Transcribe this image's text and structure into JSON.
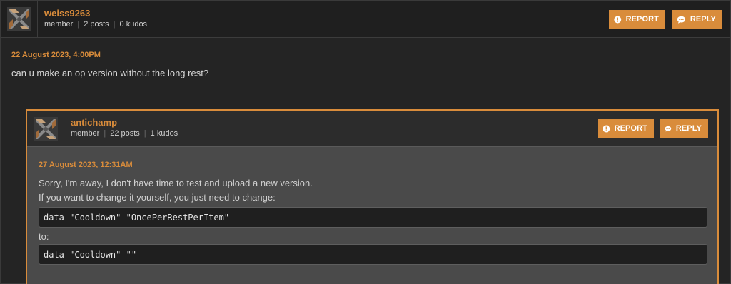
{
  "post": {
    "author": "weiss9263",
    "role": "member",
    "posts": "2 posts",
    "kudos": "0 kudos",
    "date": "22 August 2023, 4:00PM",
    "text": "can u make an op version without the long rest?",
    "report_label": "REPORT",
    "reply_label": "REPLY"
  },
  "reply": {
    "author": "antichamp",
    "role": "member",
    "posts": "22 posts",
    "kudos": "1 kudos",
    "date": "27 August 2023, 12:31AM",
    "line1": "Sorry, I'm away, I don't have time to test and upload a new version.",
    "line2": "If you want to change it yourself, you just need to change:",
    "code1": "data \"Cooldown\" \"OncePerRestPerItem\"",
    "to_label": "to:",
    "code2": "data \"Cooldown\" \"\"",
    "report_label": "REPORT",
    "reply_label": "REPLY"
  },
  "colors": {
    "accent": "#d98c3b",
    "background": "#242424",
    "reply_background": "#4a4a4a"
  },
  "icons": {
    "report": "exclamation-circle-icon",
    "reply": "speech-bubble-icon",
    "avatar": "default-avatar-icon"
  }
}
